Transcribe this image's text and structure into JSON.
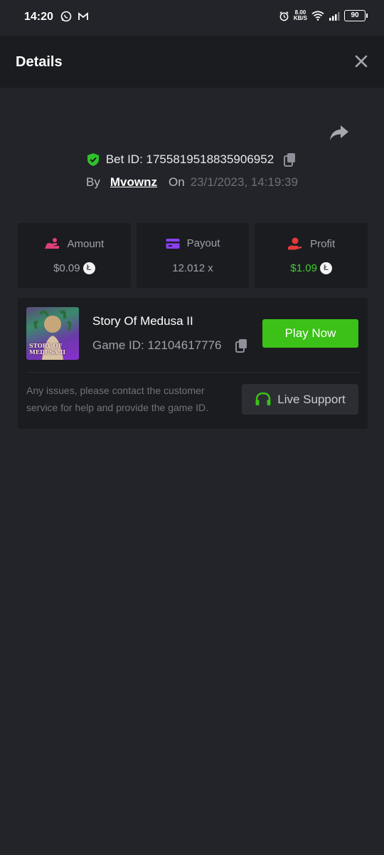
{
  "status_bar": {
    "time": "14:20",
    "net_speed": "8.00",
    "net_unit": "KB/S",
    "battery": "90"
  },
  "header": {
    "title": "Details"
  },
  "bet": {
    "id_label": "Bet ID: 1755819518835906952",
    "by_label": "By",
    "user": "Mvownz",
    "on_label": "On",
    "date": "23/1/2023, 14:19:39"
  },
  "stats": {
    "amount": {
      "label": "Amount",
      "value": "$0.09"
    },
    "payout": {
      "label": "Payout",
      "value": "12.012 x"
    },
    "profit": {
      "label": "Profit",
      "value": "$1.09"
    },
    "coin_symbol": "Ł"
  },
  "game": {
    "name": "Story Of Medusa II",
    "id_label": "Game ID: 12104617776",
    "thumb_line1": "STORY OF",
    "thumb_line2": "MEDUSA II",
    "play_label": "Play Now"
  },
  "support": {
    "help_text": "Any issues, please contact the customer service for help and provide the game ID.",
    "button_label": "Live Support"
  },
  "colors": {
    "background": "#232429",
    "panel": "#1b1c20",
    "accent_green": "#3bc117",
    "profit_green": "#3fcd2c",
    "shield_green": "#2fc12a"
  }
}
